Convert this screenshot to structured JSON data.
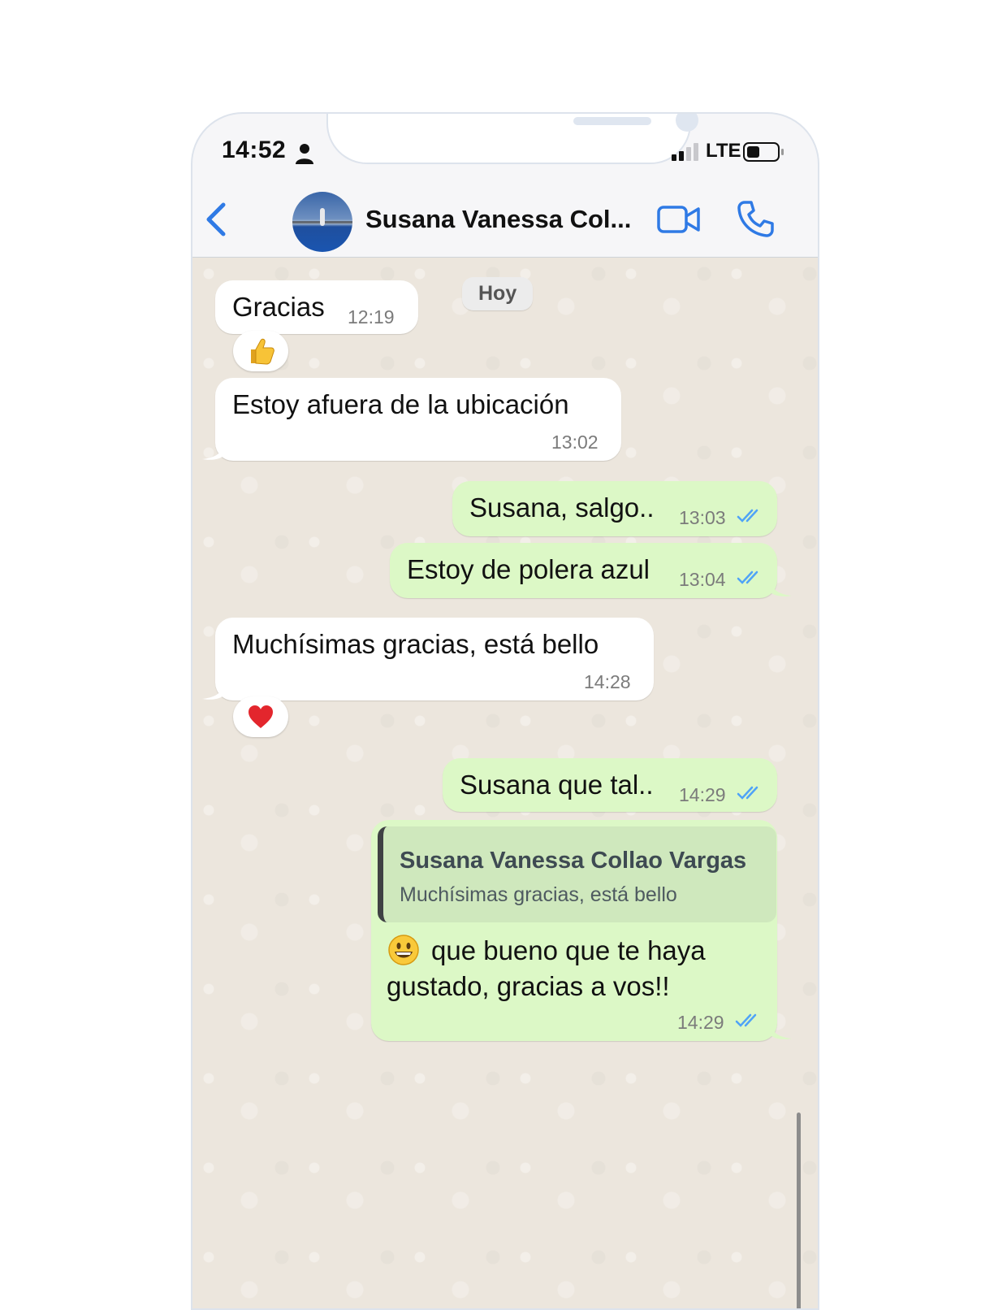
{
  "status_bar": {
    "time": "14:52",
    "network": "LTE",
    "signal_bars": 2
  },
  "header": {
    "contact_name": "Susana Vanessa Col..."
  },
  "chat": {
    "date_label": "Hoy",
    "messages": [
      {
        "direction": "in",
        "text": "Gracias",
        "time": "12:19",
        "reaction": "thumbs-up"
      },
      {
        "direction": "in",
        "text": "Estoy afuera de la ubicación",
        "time": "13:02"
      },
      {
        "direction": "out",
        "text": "Susana, salgo..",
        "time": "13:03",
        "status": "read"
      },
      {
        "direction": "out",
        "text": "Estoy de polera azul",
        "time": "13:04",
        "status": "read"
      },
      {
        "direction": "in",
        "text": "Muchísimas gracias, está bello",
        "time": "14:28",
        "reaction": "red-heart"
      },
      {
        "direction": "out",
        "text": "Susana que tal..",
        "time": "14:29",
        "status": "read"
      },
      {
        "direction": "out",
        "quote": {
          "author": "Susana Vanessa Collao Vargas",
          "text": "Muchísimas gracias, está bello"
        },
        "line1": "que bueno que te haya",
        "line2": "gustado, gracias a vos!!",
        "time": "14:29",
        "status": "read"
      }
    ]
  },
  "colors": {
    "accent": "#2f7ae5",
    "outgoing": "#dcf8c6",
    "incoming": "#ffffff",
    "wallpaper": "#ece6dd",
    "tick_read": "#4fa3f7"
  }
}
